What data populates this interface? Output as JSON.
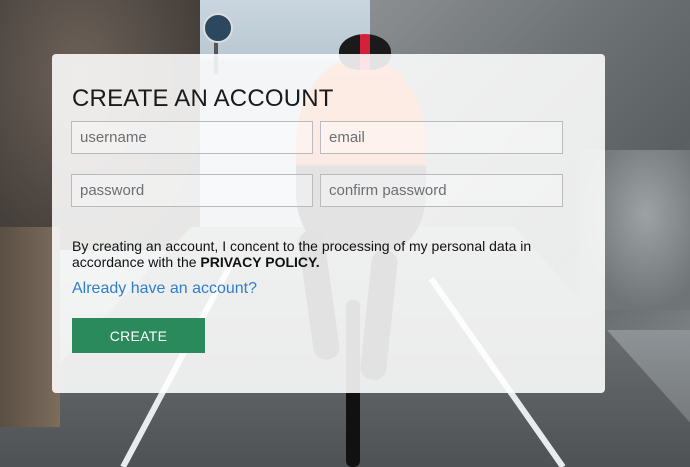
{
  "form": {
    "title": "CREATE AN ACCOUNT",
    "username_placeholder": "username",
    "email_placeholder": "email",
    "password_placeholder": "password",
    "confirm_password_placeholder": "confirm password",
    "consent_text": "By creating an account, I concent to the processing of my personal data in accordance with the ",
    "privacy_policy_label": "PRIVACY POLICY.",
    "login_link_label": "Already have an account?",
    "create_button_label": "CREATE"
  },
  "colors": {
    "button": "#2a8a5b",
    "link": "#2f7fc8"
  }
}
